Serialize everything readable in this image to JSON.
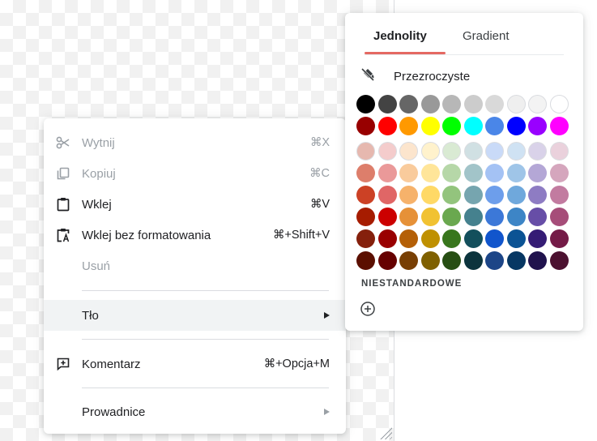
{
  "menu": {
    "items": [
      {
        "label": "Wytnij",
        "shortcut": "⌘X",
        "icon": "scissors-icon",
        "disabled": true
      },
      {
        "label": "Kopiuj",
        "shortcut": "⌘C",
        "icon": "copy-icon",
        "disabled": true
      },
      {
        "label": "Wklej",
        "shortcut": "⌘V",
        "icon": "clipboard-icon",
        "disabled": false
      },
      {
        "label": "Wklej bez formatowania",
        "shortcut": "⌘+Shift+V",
        "icon": "paste-plain-icon",
        "disabled": false
      },
      {
        "label": "Usuń",
        "shortcut": "",
        "icon": "",
        "disabled": true
      },
      {
        "label": "Tło",
        "shortcut": "",
        "icon": "",
        "disabled": false,
        "submenu": true
      },
      {
        "label": "Komentarz",
        "shortcut": "⌘+Opcja+M",
        "icon": "add-comment-icon",
        "disabled": false
      },
      {
        "label": "Prowadnice",
        "shortcut": "",
        "icon": "",
        "disabled": false,
        "submenu": true
      }
    ]
  },
  "panel": {
    "tabs": [
      "Jednolity",
      "Gradient"
    ],
    "active_tab": "Jednolity",
    "transparent_label": "Przezroczyste",
    "custom_label": "NIESTANDARDOWE",
    "accent": "#e46962",
    "colors": [
      [
        "#000000",
        "#434343",
        "#666666",
        "#999999",
        "#b7b7b7",
        "#cccccc",
        "#d9d9d9",
        "#efefef",
        "#f3f3f3",
        "#ffffff"
      ],
      [
        "#980000",
        "#ff0000",
        "#ff9900",
        "#ffff00",
        "#00ff00",
        "#00ffff",
        "#4a86e8",
        "#0000ff",
        "#9900ff",
        "#ff00ff"
      ],
      [
        "#e6b8af",
        "#f4cccc",
        "#fce5cd",
        "#fff2cc",
        "#d9ead3",
        "#d0e0e3",
        "#c9daf8",
        "#cfe2f3",
        "#d9d2e9",
        "#ead1dc"
      ],
      [
        "#dd7e6b",
        "#ea9999",
        "#f9cb9c",
        "#ffe599",
        "#b6d7a8",
        "#a2c4c9",
        "#a4c2f4",
        "#9fc5e8",
        "#b4a7d6",
        "#d5a6bd"
      ],
      [
        "#cc4125",
        "#e06666",
        "#f6b26b",
        "#ffd966",
        "#93c47d",
        "#76a5af",
        "#6d9eeb",
        "#6fa8dc",
        "#8e7cc3",
        "#c27ba0"
      ],
      [
        "#a61c00",
        "#cc0000",
        "#e69138",
        "#f1c232",
        "#6aa84f",
        "#45818e",
        "#3c78d8",
        "#3d85c6",
        "#674ea7",
        "#a64d79"
      ],
      [
        "#85200c",
        "#990000",
        "#b45f06",
        "#bf9000",
        "#38761d",
        "#134f5c",
        "#1155cc",
        "#0b5394",
        "#351c75",
        "#741b47"
      ],
      [
        "#5b0f00",
        "#660000",
        "#783f04",
        "#7f6000",
        "#274e13",
        "#0c343d",
        "#1c4587",
        "#073763",
        "#20124d",
        "#4c1130"
      ]
    ]
  }
}
